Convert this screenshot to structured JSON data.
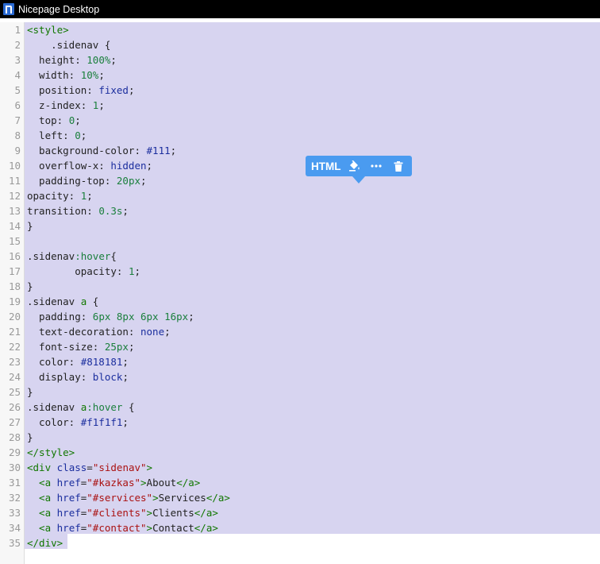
{
  "window": {
    "title": "Nicepage Desktop",
    "logo_icon": "nicepage-logo-icon"
  },
  "editor": {
    "lines": [
      {
        "n": "1",
        "tokens": [
          {
            "t": "<style>",
            "c": "tag"
          }
        ]
      },
      {
        "n": "2",
        "tokens": [
          {
            "t": "    .sidenav {",
            "c": "sel-name"
          }
        ]
      },
      {
        "n": "3",
        "tokens": [
          {
            "t": "  height: ",
            "c": "prop"
          },
          {
            "t": "100%",
            "c": "num"
          },
          {
            "t": ";",
            "c": "prop"
          }
        ]
      },
      {
        "n": "4",
        "tokens": [
          {
            "t": "  width: ",
            "c": "prop"
          },
          {
            "t": "10%",
            "c": "num"
          },
          {
            "t": ";",
            "c": "prop"
          }
        ]
      },
      {
        "n": "5",
        "tokens": [
          {
            "t": "  position: ",
            "c": "prop"
          },
          {
            "t": "fixed",
            "c": "val"
          },
          {
            "t": ";",
            "c": "prop"
          }
        ]
      },
      {
        "n": "6",
        "tokens": [
          {
            "t": "  z-index: ",
            "c": "prop"
          },
          {
            "t": "1",
            "c": "num"
          },
          {
            "t": ";",
            "c": "prop"
          }
        ]
      },
      {
        "n": "7",
        "tokens": [
          {
            "t": "  top: ",
            "c": "prop"
          },
          {
            "t": "0",
            "c": "num"
          },
          {
            "t": ";",
            "c": "prop"
          }
        ]
      },
      {
        "n": "8",
        "tokens": [
          {
            "t": "  left: ",
            "c": "prop"
          },
          {
            "t": "0",
            "c": "num"
          },
          {
            "t": ";",
            "c": "prop"
          }
        ]
      },
      {
        "n": "9",
        "tokens": [
          {
            "t": "  background-color: ",
            "c": "prop"
          },
          {
            "t": "#111",
            "c": "val"
          },
          {
            "t": ";",
            "c": "prop"
          }
        ]
      },
      {
        "n": "10",
        "tokens": [
          {
            "t": "  overflow-x: ",
            "c": "prop"
          },
          {
            "t": "hidden",
            "c": "val"
          },
          {
            "t": ";",
            "c": "prop"
          }
        ]
      },
      {
        "n": "11",
        "tokens": [
          {
            "t": "  padding-top: ",
            "c": "prop"
          },
          {
            "t": "20px",
            "c": "num"
          },
          {
            "t": ";",
            "c": "prop"
          }
        ]
      },
      {
        "n": "12",
        "tokens": [
          {
            "t": "opacity: ",
            "c": "prop"
          },
          {
            "t": "1",
            "c": "num"
          },
          {
            "t": ";",
            "c": "prop"
          }
        ]
      },
      {
        "n": "13",
        "tokens": [
          {
            "t": "transition: ",
            "c": "prop"
          },
          {
            "t": "0.3s",
            "c": "num"
          },
          {
            "t": ";",
            "c": "prop"
          }
        ]
      },
      {
        "n": "14",
        "tokens": [
          {
            "t": "}",
            "c": "prop"
          }
        ]
      },
      {
        "n": "15",
        "tokens": [
          {
            "t": "",
            "c": "prop"
          }
        ]
      },
      {
        "n": "16",
        "tokens": [
          {
            "t": ".sidenav",
            "c": "sel-name"
          },
          {
            "t": ":hover",
            "c": "pseudo"
          },
          {
            "t": "{",
            "c": "prop"
          }
        ]
      },
      {
        "n": "17",
        "tokens": [
          {
            "t": "        opacity: ",
            "c": "prop"
          },
          {
            "t": "1",
            "c": "num"
          },
          {
            "t": ";",
            "c": "prop"
          }
        ]
      },
      {
        "n": "18",
        "tokens": [
          {
            "t": "}",
            "c": "prop"
          }
        ]
      },
      {
        "n": "19",
        "tokens": [
          {
            "t": ".sidenav ",
            "c": "sel-name"
          },
          {
            "t": "a",
            "c": "tag"
          },
          {
            "t": " {",
            "c": "prop"
          }
        ]
      },
      {
        "n": "20",
        "tokens": [
          {
            "t": "  padding: ",
            "c": "prop"
          },
          {
            "t": "6px 8px 6px 16px",
            "c": "num"
          },
          {
            "t": ";",
            "c": "prop"
          }
        ]
      },
      {
        "n": "21",
        "tokens": [
          {
            "t": "  text-decoration: ",
            "c": "prop"
          },
          {
            "t": "none",
            "c": "val"
          },
          {
            "t": ";",
            "c": "prop"
          }
        ]
      },
      {
        "n": "22",
        "tokens": [
          {
            "t": "  font-size: ",
            "c": "prop"
          },
          {
            "t": "25px",
            "c": "num"
          },
          {
            "t": ";",
            "c": "prop"
          }
        ]
      },
      {
        "n": "23",
        "tokens": [
          {
            "t": "  color: ",
            "c": "prop"
          },
          {
            "t": "#818181",
            "c": "val"
          },
          {
            "t": ";",
            "c": "prop"
          }
        ]
      },
      {
        "n": "24",
        "tokens": [
          {
            "t": "  display: ",
            "c": "prop"
          },
          {
            "t": "block",
            "c": "val"
          },
          {
            "t": ";",
            "c": "prop"
          }
        ]
      },
      {
        "n": "25",
        "tokens": [
          {
            "t": "}",
            "c": "prop"
          }
        ]
      },
      {
        "n": "26",
        "tokens": [
          {
            "t": ".sidenav ",
            "c": "sel-name"
          },
          {
            "t": "a",
            "c": "tag"
          },
          {
            "t": ":hover",
            "c": "pseudo"
          },
          {
            "t": " {",
            "c": "prop"
          }
        ]
      },
      {
        "n": "27",
        "tokens": [
          {
            "t": "  color: ",
            "c": "prop"
          },
          {
            "t": "#f1f1f1",
            "c": "val"
          },
          {
            "t": ";",
            "c": "prop"
          }
        ]
      },
      {
        "n": "28",
        "tokens": [
          {
            "t": "}",
            "c": "prop"
          }
        ]
      },
      {
        "n": "29",
        "tokens": [
          {
            "t": "</style>",
            "c": "tag"
          }
        ]
      },
      {
        "n": "30",
        "tokens": [
          {
            "t": "<div ",
            "c": "tag"
          },
          {
            "t": "class",
            "c": "attr"
          },
          {
            "t": "=",
            "c": "prop"
          },
          {
            "t": "\"sidenav\"",
            "c": "str"
          },
          {
            "t": ">",
            "c": "tag"
          }
        ]
      },
      {
        "n": "31",
        "tokens": [
          {
            "t": "  <a ",
            "c": "tag"
          },
          {
            "t": "href",
            "c": "attr"
          },
          {
            "t": "=",
            "c": "prop"
          },
          {
            "t": "\"#kazkas\"",
            "c": "str"
          },
          {
            "t": ">",
            "c": "tag"
          },
          {
            "t": "About",
            "c": "prop"
          },
          {
            "t": "</a>",
            "c": "tag"
          }
        ]
      },
      {
        "n": "32",
        "tokens": [
          {
            "t": "  <a ",
            "c": "tag"
          },
          {
            "t": "href",
            "c": "attr"
          },
          {
            "t": "=",
            "c": "prop"
          },
          {
            "t": "\"#services\"",
            "c": "str"
          },
          {
            "t": ">",
            "c": "tag"
          },
          {
            "t": "Services",
            "c": "prop"
          },
          {
            "t": "</a>",
            "c": "tag"
          }
        ]
      },
      {
        "n": "33",
        "tokens": [
          {
            "t": "  <a ",
            "c": "tag"
          },
          {
            "t": "href",
            "c": "attr"
          },
          {
            "t": "=",
            "c": "prop"
          },
          {
            "t": "\"#clients\"",
            "c": "str"
          },
          {
            "t": ">",
            "c": "tag"
          },
          {
            "t": "Clients",
            "c": "prop"
          },
          {
            "t": "</a>",
            "c": "tag"
          }
        ]
      },
      {
        "n": "34",
        "tokens": [
          {
            "t": "  <a ",
            "c": "tag"
          },
          {
            "t": "href",
            "c": "attr"
          },
          {
            "t": "=",
            "c": "prop"
          },
          {
            "t": "\"#contact\"",
            "c": "str"
          },
          {
            "t": ">",
            "c": "tag"
          },
          {
            "t": "Contact",
            "c": "prop"
          },
          {
            "t": "</a>",
            "c": "tag"
          }
        ]
      },
      {
        "n": "35",
        "tokens": [
          {
            "t": "</div>",
            "c": "tag"
          }
        ]
      }
    ]
  },
  "popup": {
    "label": "HTML",
    "buttons": [
      {
        "name": "paint-bucket-icon"
      },
      {
        "name": "more-icon"
      },
      {
        "name": "trash-icon"
      }
    ],
    "bg_color": "#4a9bf0"
  },
  "colors": {
    "selection": "#d7d4f0",
    "titlebar": "#000000"
  }
}
